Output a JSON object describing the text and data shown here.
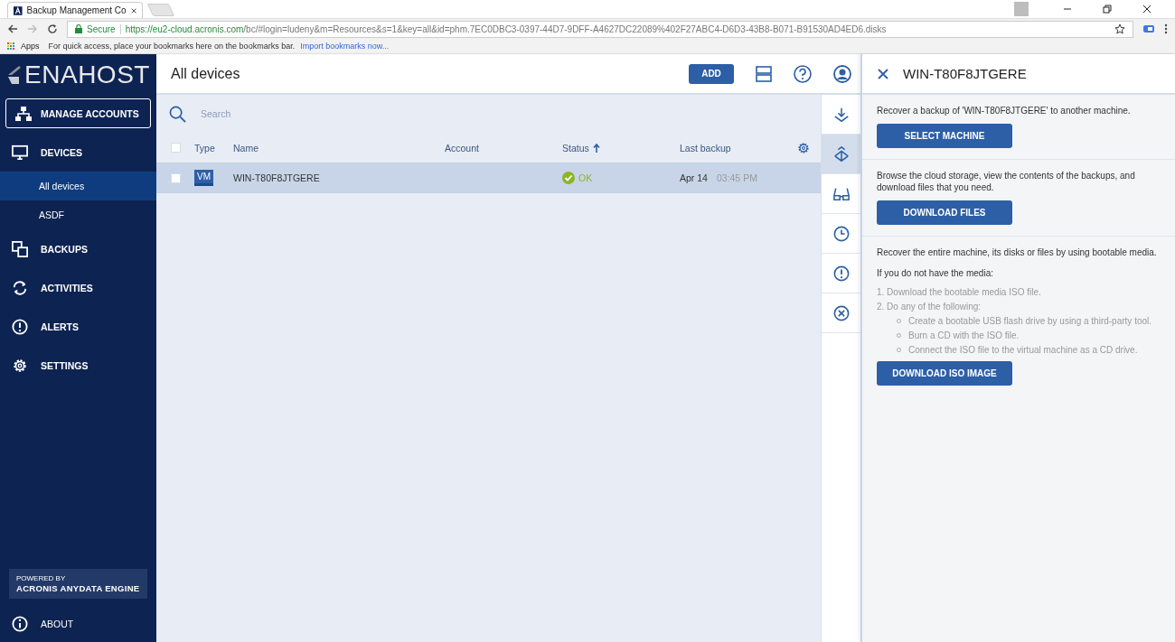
{
  "browser": {
    "tab_title": "Backup Management Co",
    "secure_label": "Secure",
    "url_host": "https://eu2-cloud.acronis.com",
    "url_path": "/bc/#login=ludeny&m=Resources&s=1&key=all&id=phm.7EC0DBC3-0397-44D7-9DFF-A4627DC22089%402F27ABC4-D6D3-43B8-B071-B91530AD4ED6.disks",
    "apps_label": "Apps",
    "bookmarks_hint": "For quick access, place your bookmarks here on the bookmarks bar.",
    "import_link": "Import bookmarks now..."
  },
  "sidebar": {
    "logo": "ENAHOST",
    "manage_accounts": "MANAGE ACCOUNTS",
    "items": [
      {
        "label": "DEVICES",
        "kind": "devices",
        "selected": false,
        "children": [
          {
            "label": "All devices",
            "selected": true
          },
          {
            "label": "ASDF",
            "selected": false
          }
        ]
      },
      {
        "label": "BACKUPS",
        "kind": "backups",
        "selected": false
      },
      {
        "label": "ACTIVITIES",
        "kind": "activities",
        "selected": false
      },
      {
        "label": "ALERTS",
        "kind": "alerts",
        "selected": false
      },
      {
        "label": "SETTINGS",
        "kind": "settings",
        "selected": false
      }
    ],
    "powered_by": "POWERED BY",
    "engine": "ACRONIS ANYDATA ENGINE",
    "about": "ABOUT"
  },
  "main": {
    "title": "All devices",
    "select_all_checked": false,
    "add_button": "ADD",
    "search": {
      "placeholder": "Search"
    },
    "columns": [
      {
        "label": "Type",
        "sorted": false
      },
      {
        "label": "Name",
        "sorted": false
      },
      {
        "label": "Account",
        "sorted": false
      },
      {
        "label": "Status",
        "sorted": true
      },
      {
        "label": "Last backup",
        "sorted": false
      }
    ],
    "rows": [
      {
        "type": "VM",
        "name": "WIN-T80F8JTGERE",
        "status": {
          "text": "OK",
          "kind": "success"
        },
        "date": "Apr 14",
        "time": "03:45 PM",
        "selected": true,
        "checked": false
      }
    ]
  },
  "actions": [
    {
      "kind": "download",
      "selected": false
    },
    {
      "kind": "recover",
      "selected": true
    },
    {
      "kind": "glasses",
      "selected": false
    },
    {
      "kind": "clock",
      "selected": false
    },
    {
      "kind": "alert",
      "selected": false
    },
    {
      "kind": "cancel",
      "selected": false
    }
  ],
  "panel": {
    "title": "WIN-T80F8JTGERE",
    "sections": [
      {
        "text": "Recover a backup of 'WIN-T80F8JTGERE' to another machine.",
        "button": "SELECT MACHINE"
      },
      {
        "text": "Browse the cloud storage, view the contents of the backups, and download files that you need.",
        "button": "DOWNLOAD FILES"
      },
      {
        "text": "Recover the entire machine, its disks or files by using bootable media.",
        "subheading": "If you do not have the media:",
        "steps": [
          {
            "text": "1. Download the bootable media ISO file."
          },
          {
            "text": "2. Do any of the following:",
            "children": [
              "Create a bootable USB flash drive by using a third-party tool.",
              "Burn a CD with the ISO file.",
              "Connect the ISO file to the virtual machine as a CD drive."
            ]
          }
        ],
        "button": "DOWNLOAD ISO IMAGE"
      }
    ]
  }
}
